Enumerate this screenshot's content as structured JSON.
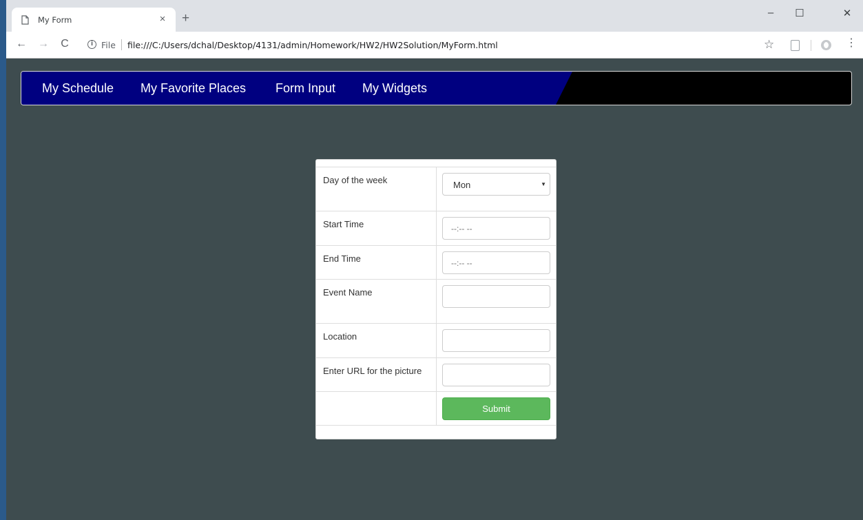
{
  "browser": {
    "tab_title": "My Form",
    "tab_close": "×",
    "new_tab": "+",
    "window_controls": {
      "minimize": "–",
      "maximize": "☐",
      "close": "✕"
    },
    "nav": {
      "back": "←",
      "forward": "→",
      "reload": "C"
    },
    "omnibox": {
      "info": "i",
      "protocol_label": "File",
      "url": "file:///C:/Users/dchal/Desktop/4131/admin/Homework/HW2/HW2Solution/MyForm.html"
    },
    "bookmark_star": "☆",
    "menu": "⋮"
  },
  "navbar": {
    "items": [
      {
        "label": "My Schedule"
      },
      {
        "label": "My Favorite Places"
      },
      {
        "label": "Form Input"
      },
      {
        "label": "My Widgets"
      }
    ],
    "colors": {
      "primary": "#000080",
      "secondary": "#000000"
    }
  },
  "form": {
    "day": {
      "label": "Day of the week",
      "value": "Mon"
    },
    "start_time": {
      "label": "Start Time",
      "placeholder": "--:-- --"
    },
    "end_time": {
      "label": "End Time",
      "placeholder": "--:-- --"
    },
    "event_name": {
      "label": "Event Name",
      "value": ""
    },
    "location": {
      "label": "Location",
      "value": ""
    },
    "picture_url": {
      "label": "Enter URL for the picture",
      "value": ""
    },
    "submit_label": "Submit",
    "submit_color": "#5cb85c"
  },
  "page_background": "#3e4c4f"
}
